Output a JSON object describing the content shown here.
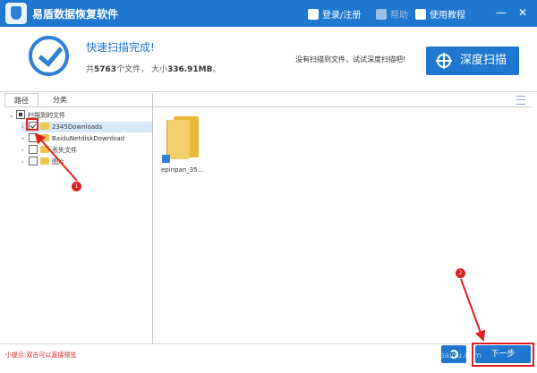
{
  "app": {
    "title": "易盾数据恢复软件",
    "toolbar": {
      "login": "登录/注册",
      "help": "帮助",
      "tutorial": "使用教程"
    },
    "window_controls": [
      "—",
      "✕"
    ]
  },
  "status": {
    "title": "快速扫描完成!",
    "summary_prefix": "共",
    "file_count": "5763",
    "summary_mid": "个文件， 大小",
    "total_size": "336.91MB",
    "summary_end": "。",
    "deep_hint": "没有扫描到文件，试试深度扫描吧!",
    "deep_button": "深度扫描"
  },
  "tabs": [
    "路径",
    "分类"
  ],
  "tree": {
    "root": "扫描到的文件",
    "items": [
      {
        "label": "2345Downloads",
        "checked": true,
        "selected": true
      },
      {
        "label": "BaiduNetdiskDownload",
        "checked": false,
        "selected": false
      },
      {
        "label": "丢失文件",
        "checked": false,
        "selected": false
      },
      {
        "label": "图片",
        "checked": false,
        "selected": false
      }
    ]
  },
  "content": {
    "file_label": "epinpan_35..."
  },
  "footer": {
    "hint": "小提示:双击可以直接预览",
    "next_button": "下一步"
  },
  "annotations": {
    "badge_1": "1",
    "badge_2": "2",
    "watermark": "jingyan.baidu.com"
  },
  "colors": {
    "accent": "#1f77d0",
    "annotation_red": "#e02020",
    "folder": "#f4d06c"
  }
}
